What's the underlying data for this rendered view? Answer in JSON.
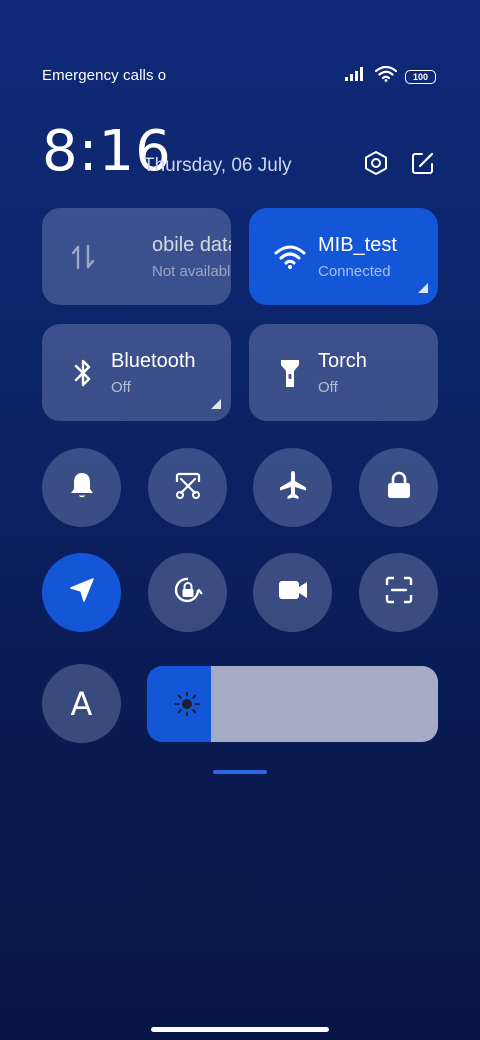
{
  "status_bar": {
    "carrier_text": "Emergency calls o",
    "battery": "100",
    "icons": [
      "signal-icon",
      "wifi-icon",
      "battery-icon"
    ]
  },
  "header": {
    "time": "8:16",
    "date": "Thursday, 06 July",
    "buttons": [
      "settings-icon",
      "edit-icon"
    ]
  },
  "tiles": {
    "mobile_data": {
      "title": "obile data",
      "status": "Not available",
      "icon": "data-arrows-icon",
      "enabled": false
    },
    "wifi": {
      "title": "MIB_test",
      "status": "Connected",
      "icon": "wifi-icon",
      "active": true
    },
    "bluetooth": {
      "title": "Bluetooth",
      "status": "Off",
      "icon": "bluetooth-icon",
      "active": false
    },
    "torch": {
      "title": "Torch",
      "status": "Off",
      "icon": "torch-icon",
      "active": false
    }
  },
  "toggles_row1": [
    "bell-icon",
    "screenshot-icon",
    "airplane-icon",
    "lock-icon"
  ],
  "toggles_row2": [
    "location-icon",
    "rotation-lock-icon",
    "video-camera-icon",
    "scanner-icon"
  ],
  "auto_brightness": {
    "label": "A"
  },
  "brightness": {
    "level": 0.22,
    "icon": "sun-icon"
  },
  "colors": {
    "accent": "#1456d8",
    "tile_inactive": "#5d6b9a",
    "slider_track": "#a4abc4"
  }
}
